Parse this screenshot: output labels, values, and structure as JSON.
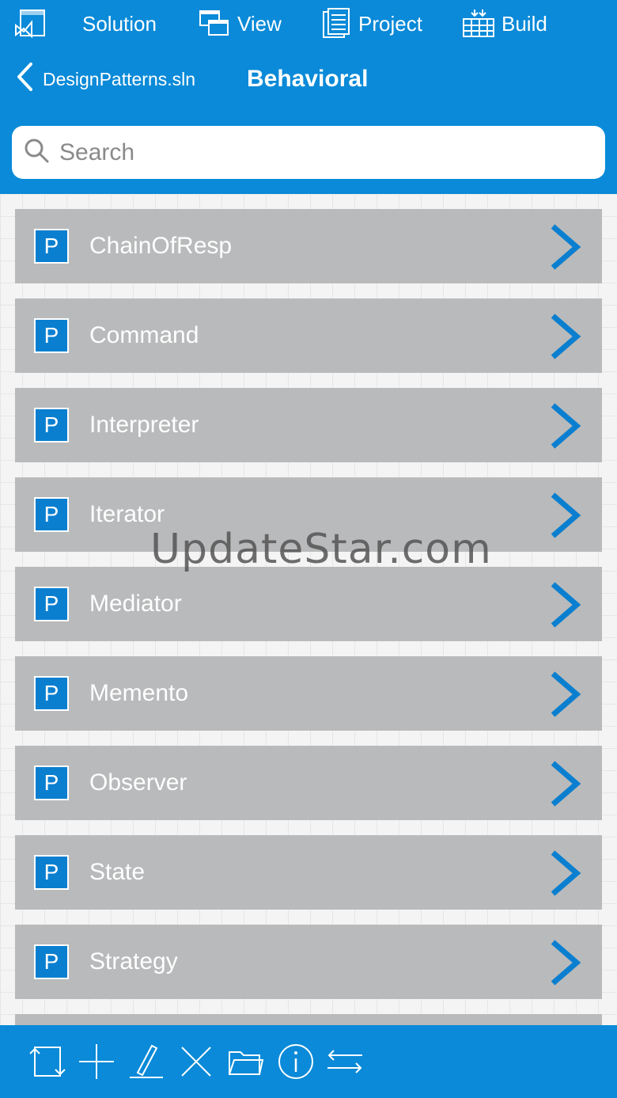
{
  "menu": {
    "solution_label": "Solution",
    "view_label": "View",
    "project_label": "Project",
    "build_label": "Build"
  },
  "nav": {
    "back_label": "DesignPatterns.sln",
    "title": "Behavioral"
  },
  "search": {
    "placeholder": "Search",
    "value": ""
  },
  "list": {
    "items": [
      {
        "badge": "P",
        "label": "ChainOfResp"
      },
      {
        "badge": "P",
        "label": "Command"
      },
      {
        "badge": "P",
        "label": "Interpreter"
      },
      {
        "badge": "P",
        "label": "Iterator"
      },
      {
        "badge": "P",
        "label": "Mediator"
      },
      {
        "badge": "P",
        "label": "Memento"
      },
      {
        "badge": "P",
        "label": "Observer"
      },
      {
        "badge": "P",
        "label": "State"
      },
      {
        "badge": "P",
        "label": "Strategy"
      }
    ]
  },
  "watermark": "UpdateStar.com",
  "toolbar": {
    "tools": [
      "sync-icon",
      "add-icon",
      "edit-icon",
      "delete-icon",
      "folder-icon",
      "info-icon",
      "transfer-icon"
    ]
  },
  "colors": {
    "accent": "#0a8ad8",
    "row_bg": "#b9babb",
    "badge_bg": "#0a7fd0",
    "chevron": "#0a7fd0"
  }
}
